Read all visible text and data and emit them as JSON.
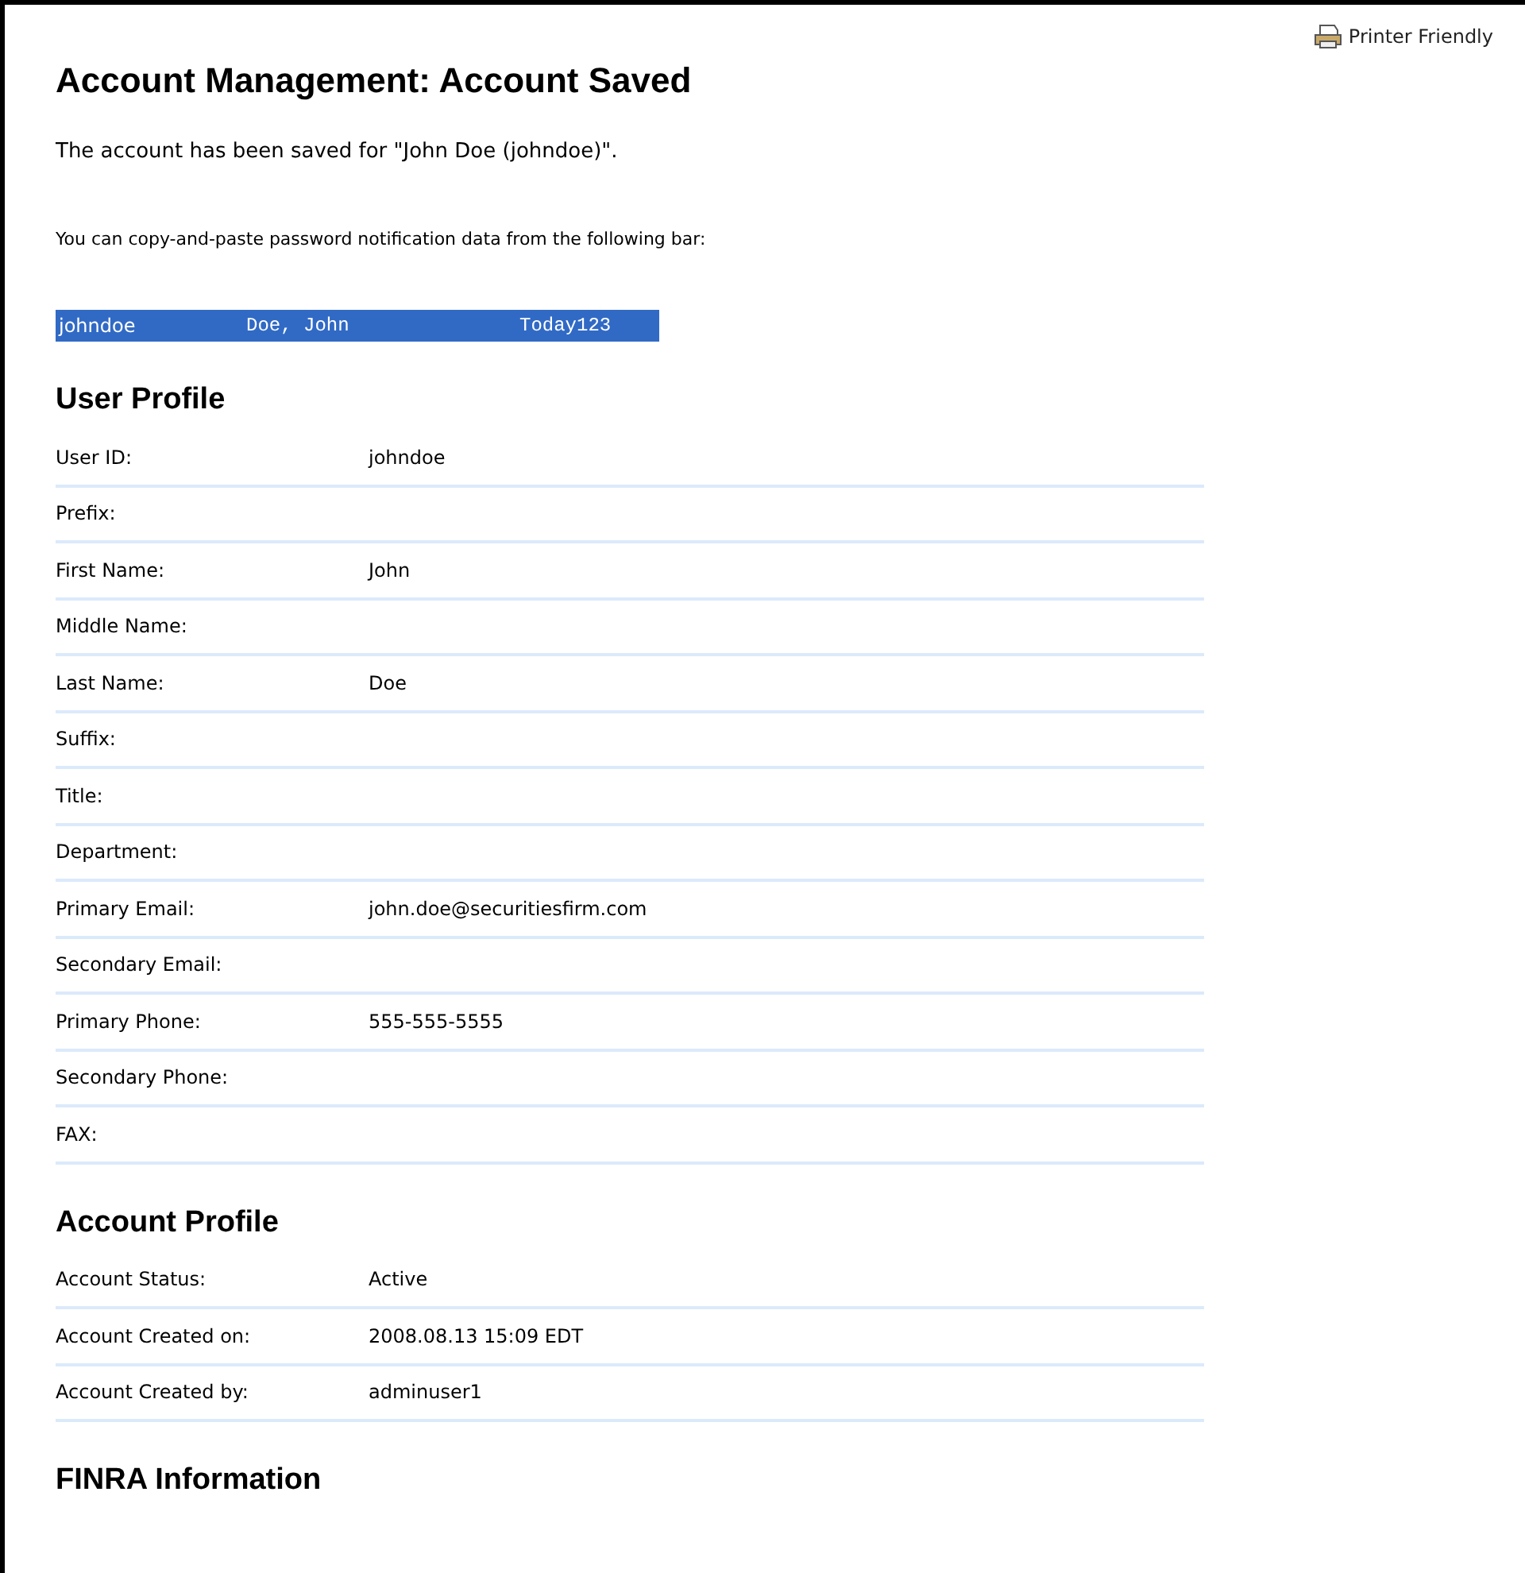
{
  "printer_link": "Printer Friendly",
  "title": "Account Management: Account Saved",
  "saved_message": "The account has been saved for \"John Doe (johndoe)\".",
  "copy_hint": "You can copy-and-paste password notification data from the following bar:",
  "notification_bar": {
    "user_id": "johndoe",
    "name": "Doe, John",
    "password": "Today123"
  },
  "sections": [
    {
      "heading": "User Profile",
      "rows": [
        {
          "label": "User ID:",
          "value": "johndoe"
        },
        {
          "label": "Prefix:"
        },
        {
          "label": "First Name:",
          "value": "John"
        },
        {
          "label": "Middle Name:"
        },
        {
          "label": "Last Name:",
          "value": "Doe"
        },
        {
          "label": "Suffix:"
        },
        {
          "label": "Title:"
        },
        {
          "label": "Department:"
        },
        {
          "label": "Primary Email:",
          "value": "john.doe@securitiesfirm.com"
        },
        {
          "label": "Secondary Email:"
        },
        {
          "label": "Primary Phone:",
          "value": "555-555-5555"
        },
        {
          "label": "Secondary Phone:"
        },
        {
          "label": "FAX:"
        }
      ]
    },
    {
      "heading": "Account Profile",
      "rows": [
        {
          "label": "Account Status:",
          "value": "Active"
        },
        {
          "label": "Account Created on:",
          "value": "2008.08.13 15:09 EDT"
        },
        {
          "label": "Account Created by:",
          "value": "adminuser1"
        }
      ]
    },
    {
      "heading": "FINRA Information"
    }
  ]
}
